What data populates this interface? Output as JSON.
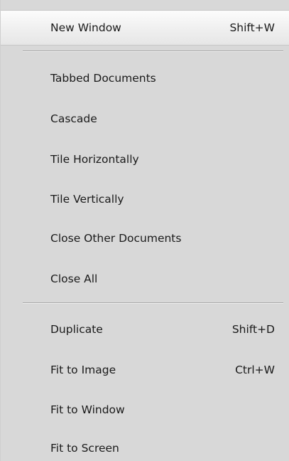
{
  "menu": {
    "items": [
      {
        "label": "New Window",
        "shortcut": "Shift+W"
      },
      {
        "label": "Tabbed Documents",
        "shortcut": ""
      },
      {
        "label": "Cascade",
        "shortcut": ""
      },
      {
        "label": "Tile Horizontally",
        "shortcut": ""
      },
      {
        "label": "Tile Vertically",
        "shortcut": ""
      },
      {
        "label": "Close Other Documents",
        "shortcut": ""
      },
      {
        "label": "Close All",
        "shortcut": ""
      },
      {
        "label": "Duplicate",
        "shortcut": "Shift+D"
      },
      {
        "label": "Fit to Image",
        "shortcut": "Ctrl+W"
      },
      {
        "label": "Fit to Window",
        "shortcut": ""
      },
      {
        "label": "Fit to Screen",
        "shortcut": ""
      }
    ],
    "highlighted_item": "New Window"
  }
}
